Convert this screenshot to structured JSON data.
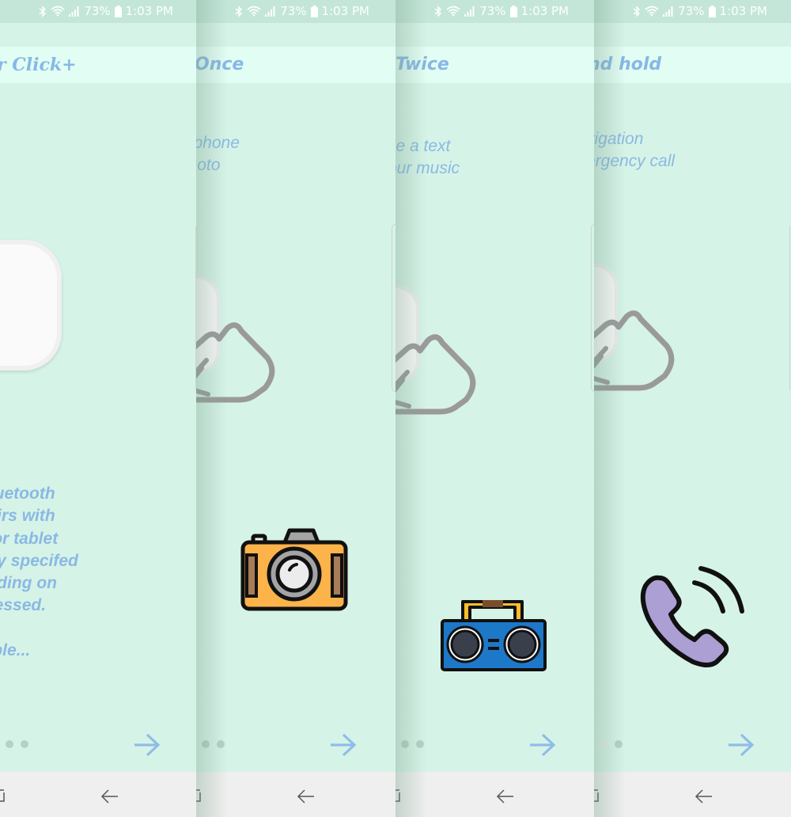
{
  "status_bar": {
    "battery": "73%",
    "time": "1:03 PM",
    "icons": [
      "bluetooth-icon",
      "wifi-icon",
      "signal-icon",
      "battery-icon"
    ]
  },
  "panels": [
    {
      "title": "r Click+",
      "intro_text": "  Bluetooth\n  pairs with\nne or tablet\n  any specifed\n  ending on\n  pressed.\n\nample...",
      "page_dots": {
        "count": 3,
        "active_index": null
      },
      "next_label": "next-arrow"
    },
    {
      "title": "Once",
      "description": "ur phone\n photo",
      "illustration": "camera-icon",
      "page_dots": {
        "count": 3,
        "active_index": null
      }
    },
    {
      "title": "Twice",
      "description": "se a text\nour music",
      "illustration": "boombox-icon",
      "page_dots": {
        "count": 3,
        "active_index": null
      }
    },
    {
      "title": "nd hold",
      "description": "vigation\nergency call",
      "illustration": "phone-call-icon",
      "page_dots": {
        "count": 3,
        "active_index": 1
      }
    }
  ],
  "colors": {
    "background": "#d6f3e7",
    "title_bar": "#e2fdf3",
    "status_bar": "#c3e6d8",
    "accent_text": "#8ab9e4",
    "nav_bar": "#efefef"
  }
}
